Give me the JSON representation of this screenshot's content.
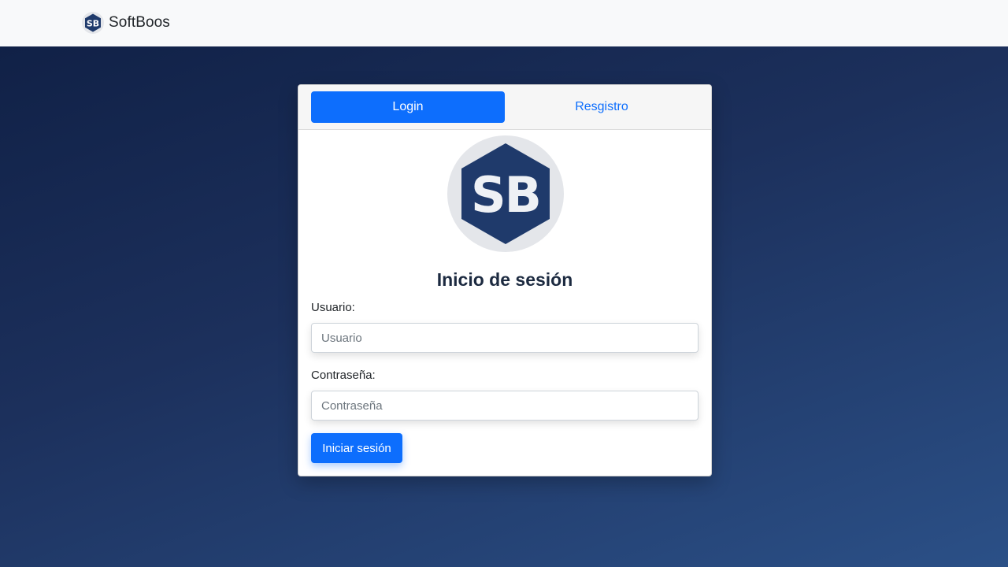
{
  "navbar": {
    "brand_logo_text": "SB",
    "brand_name": "SoftBoos"
  },
  "tabs": {
    "login_label": "Login",
    "register_label": "Resgistro"
  },
  "card": {
    "logo_text": "SB",
    "title": "Inicio de sesión"
  },
  "form": {
    "username_label": "Usuario:",
    "username_placeholder": "Usuario",
    "username_value": "",
    "password_label": "Contraseña:",
    "password_placeholder": "Contraseña",
    "password_value": "",
    "submit_label": "Iniciar sesión"
  },
  "colors": {
    "primary": "#0d6efd",
    "logo_hexagon": "#1f3a6b",
    "logo_circle": "#e4e6ea",
    "background_dark": "#0f1f44",
    "background_light": "#2b5087"
  },
  "icons": {
    "brand": "sb-hexagon-logo",
    "card_logo": "sb-hexagon-logo"
  }
}
